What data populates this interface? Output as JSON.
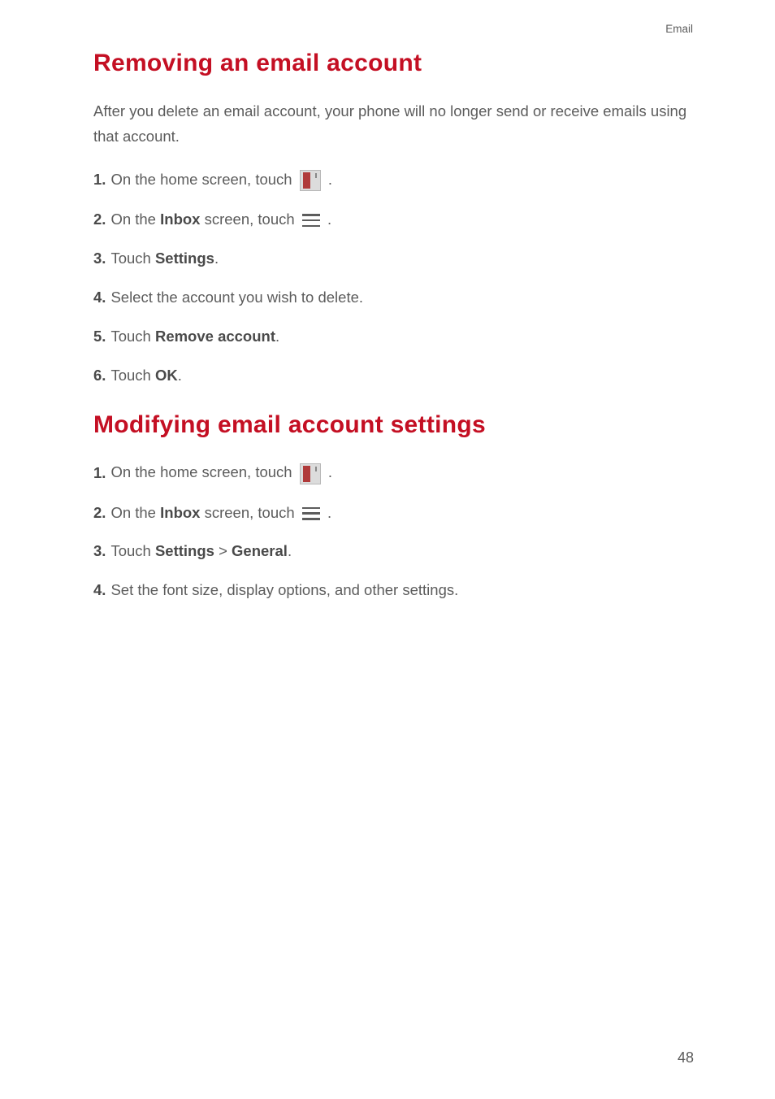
{
  "header": {
    "section_label": "Email"
  },
  "section1": {
    "title": "Removing an email account",
    "intro": "After you delete an email account, your phone will no longer send or receive emails using that account.",
    "steps": [
      {
        "number": "1.",
        "prefix": "On the home screen, touch ",
        "icon": "email",
        "suffix": "."
      },
      {
        "number": "2.",
        "prefix": "On the ",
        "bold1": "Inbox",
        "mid": " screen, touch ",
        "icon": "menu",
        "suffix": "."
      },
      {
        "number": "3.",
        "prefix": "Touch ",
        "bold1": "Settings",
        "suffix": "."
      },
      {
        "number": "4.",
        "prefix": "Select the account you wish to delete."
      },
      {
        "number": "5.",
        "prefix": "Touch ",
        "bold1": "Remove account",
        "suffix": "."
      },
      {
        "number": "6.",
        "prefix": "Touch ",
        "bold1": "OK",
        "suffix": "."
      }
    ]
  },
  "section2": {
    "title": "Modifying email account settings",
    "steps": [
      {
        "number": "1.",
        "prefix": "On the home screen, touch ",
        "icon": "email",
        "suffix": "."
      },
      {
        "number": "2.",
        "prefix": "On the ",
        "bold1": "Inbox",
        "mid": " screen, touch ",
        "icon": "menu",
        "suffix": "."
      },
      {
        "number": "3.",
        "prefix": "Touch ",
        "bold1": "Settings",
        "mid": " > ",
        "bold2": "General",
        "suffix": "."
      },
      {
        "number": "4.",
        "prefix": "Set the font size, display options, and other settings."
      }
    ]
  },
  "page_number": "48"
}
